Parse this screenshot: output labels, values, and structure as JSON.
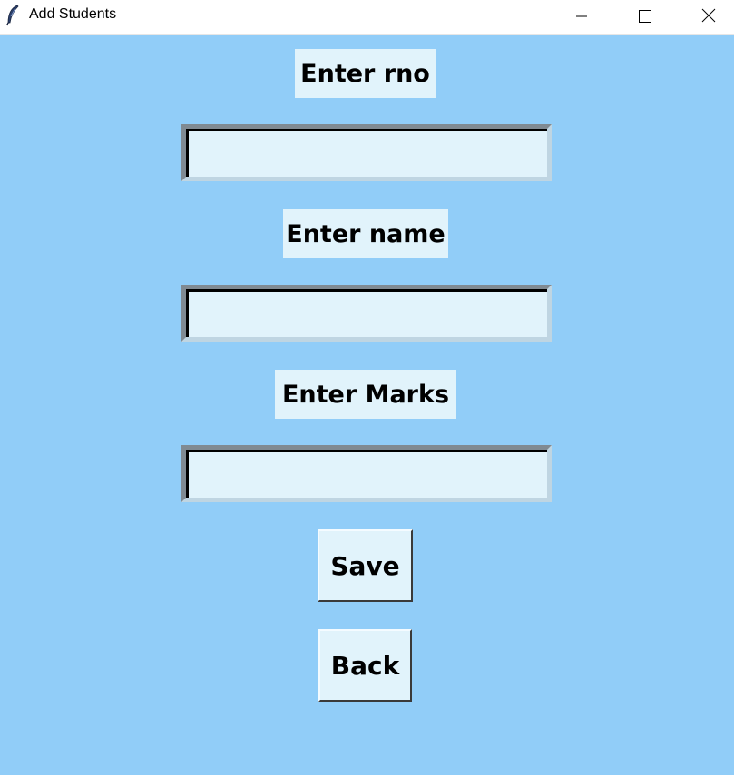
{
  "window": {
    "title": "Add Students",
    "app_icon": "feather-icon",
    "controls": {
      "minimize_icon": "minimize-icon",
      "maximize_icon": "maximize-icon",
      "close_icon": "close-icon"
    }
  },
  "colors": {
    "background": "#91cdf8",
    "widget_bg": "#e1f3fb",
    "text": "#000000"
  },
  "form": {
    "rno": {
      "label": "Enter rno",
      "value": ""
    },
    "name": {
      "label": "Enter name",
      "value": ""
    },
    "marks": {
      "label": "Enter Marks",
      "value": ""
    },
    "save_label": "Save",
    "back_label": "Back"
  }
}
